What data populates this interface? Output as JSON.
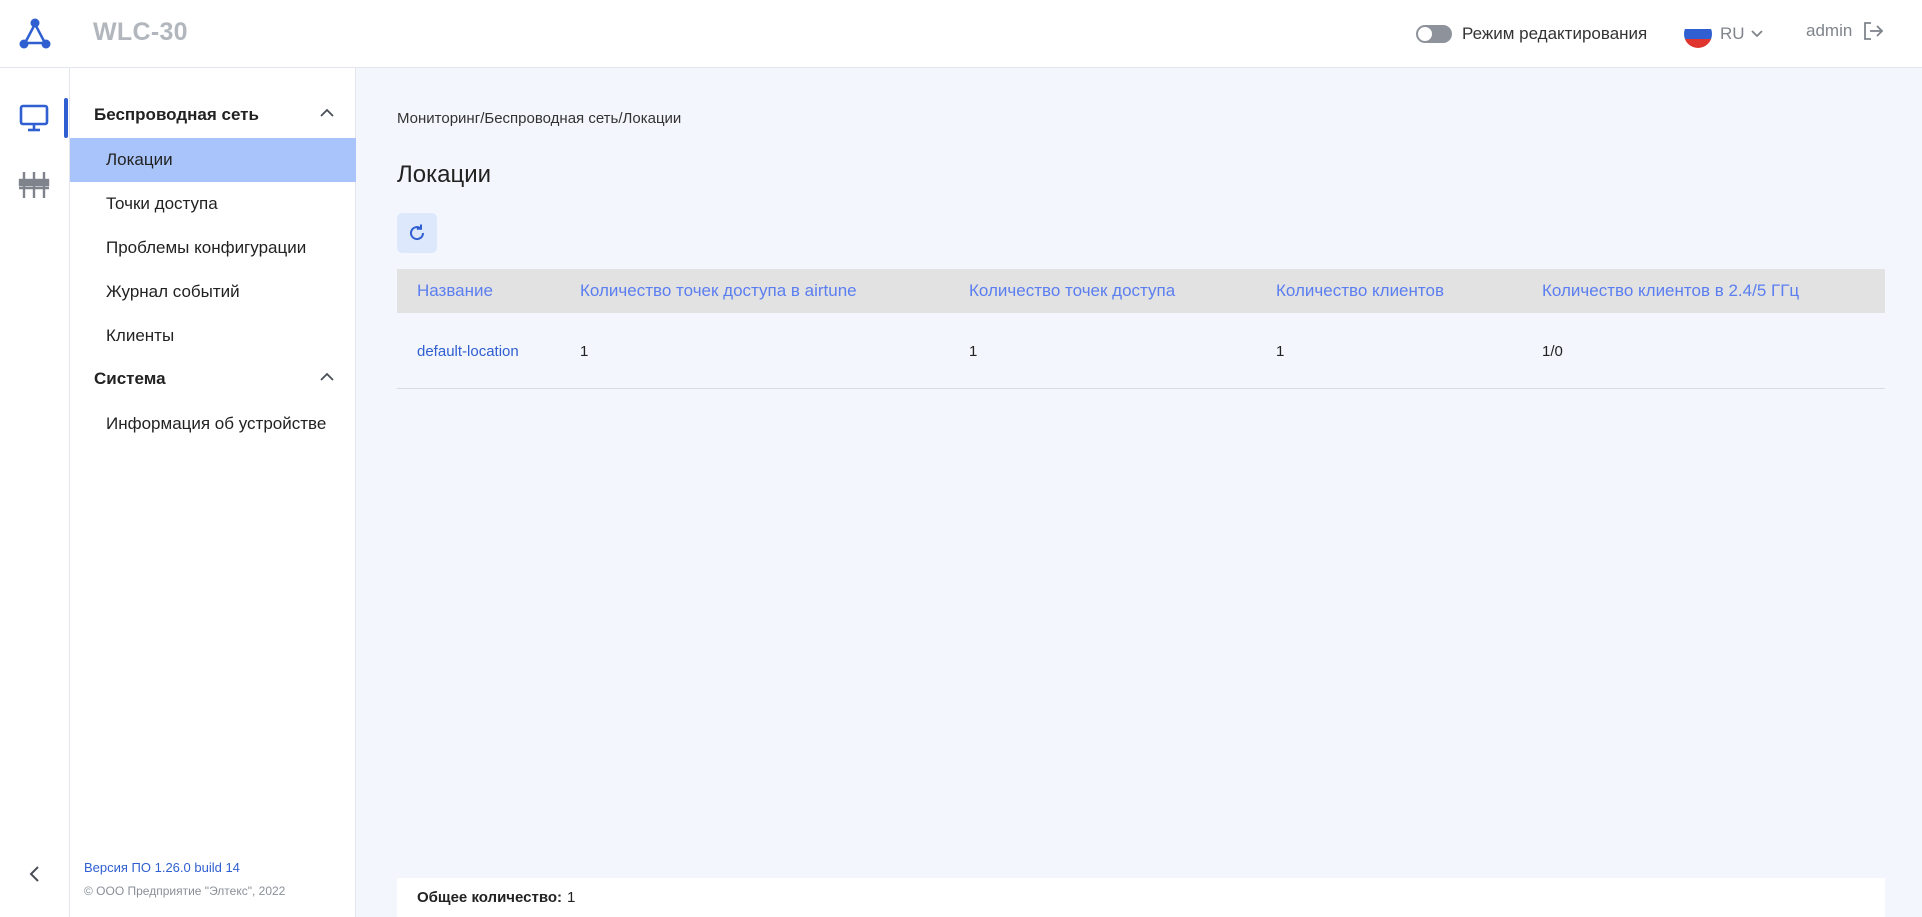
{
  "header": {
    "app_title": "WLC-30",
    "edit_mode_label": "Режим редактирования",
    "language": "RU",
    "user": "admin",
    "flag_colors": [
      "#ffffff",
      "#2f5fd0",
      "#e0342f"
    ]
  },
  "rail": {
    "items": [
      {
        "name": "monitoring",
        "icon": "monitor-icon",
        "active": true
      },
      {
        "name": "settings",
        "icon": "sliders-icon",
        "active": false
      }
    ]
  },
  "sidebar": {
    "groups": [
      {
        "label": "Беспроводная сеть",
        "items": [
          {
            "label": "Локации",
            "active": true
          },
          {
            "label": "Точки доступа"
          },
          {
            "label": "Проблемы конфигурации"
          },
          {
            "label": "Журнал событий"
          },
          {
            "label": "Клиенты"
          }
        ]
      },
      {
        "label": "Система",
        "items": [
          {
            "label": "Информация об устройстве"
          }
        ]
      }
    ],
    "version": "Версия ПО 1.26.0 build 14",
    "copyright": "© ООО Предприятие \"Элтекс\", 2022"
  },
  "main": {
    "breadcrumb": "Мониторинг/Беспроводная сеть/Локации",
    "title": "Локации",
    "table": {
      "columns": [
        "Название",
        "Количество точек доступа в airtune",
        "Количество точек доступа",
        "Количество клиентов",
        "Количество клиентов в 2.4/5 ГГц"
      ],
      "rows": [
        [
          "default-location",
          "1",
          "1",
          "1",
          "1/0"
        ]
      ]
    },
    "footer": {
      "total_label": "Общее количество:",
      "total_value": "1"
    }
  },
  "colors": {
    "accent": "#2f5fd0",
    "active_item": "#a9c4fb",
    "header_link": "#5b7ef0"
  }
}
